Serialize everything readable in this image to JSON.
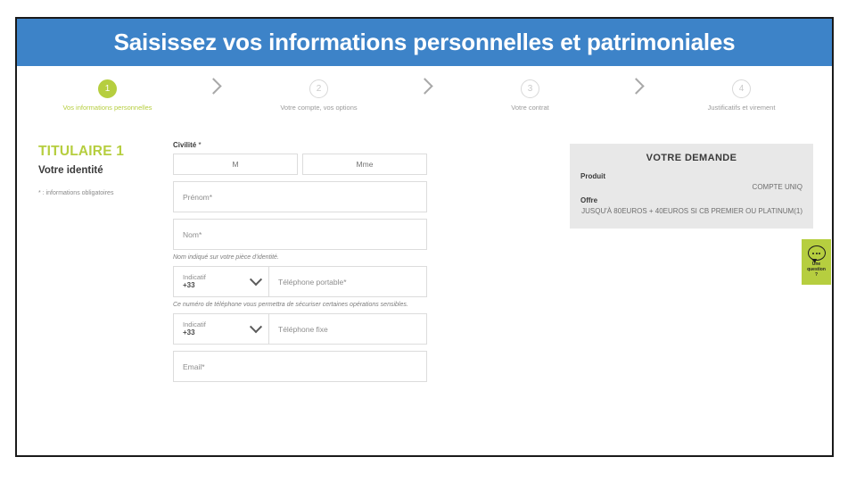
{
  "banner": {
    "title": "Saisissez vos informations personnelles et patrimoniales",
    "background_color": "#3d83c8"
  },
  "theme": {
    "accent_green": "#b6ce3f",
    "header_blue": "#3d83c8",
    "panel_gray": "#e8e8e8"
  },
  "stepper": {
    "steps": [
      {
        "number": "1",
        "label": "Vos informations personnelles",
        "state": "active"
      },
      {
        "number": "2",
        "label": "Votre compte, vos options",
        "state": "inactive"
      },
      {
        "number": "3",
        "label": "Votre contrat",
        "state": "inactive"
      },
      {
        "number": "4",
        "label": "Justificatifs et virement",
        "state": "inactive"
      }
    ]
  },
  "left": {
    "titulaire": "TITULAIRE 1",
    "subtitle": "Votre identité",
    "required_note": ": informations obligatoires",
    "required_mark": "*"
  },
  "form": {
    "civilite": {
      "label": "Civilité",
      "required_mark": "*",
      "options": [
        {
          "label": "M"
        },
        {
          "label": "Mme"
        }
      ]
    },
    "prenom": {
      "placeholder": "Prénom",
      "required_mark": "*",
      "value": ""
    },
    "nom": {
      "placeholder": "Nom",
      "required_mark": "*",
      "value": ""
    },
    "nom_helper": "Nom indiqué sur votre pièce d'identité.",
    "mobile": {
      "indicatif_label": "Indicatif",
      "indicatif_value": "+33",
      "placeholder": "Téléphone portable",
      "required_mark": "*",
      "value": ""
    },
    "mobile_helper": "Ce numéro de téléphone vous permettra de sécuriser certaines opérations sensibles.",
    "fixe": {
      "indicatif_label": "Indicatif",
      "indicatif_value": "+33",
      "placeholder": "Téléphone fixe",
      "required_mark": "",
      "value": ""
    },
    "email": {
      "placeholder": "Email",
      "required_mark": "*",
      "value": ""
    }
  },
  "summary": {
    "title": "VOTRE DEMANDE",
    "rows": [
      {
        "key": "Produit",
        "value": "COMPTE UNIQ"
      },
      {
        "key": "Offre",
        "value": "JUSQU'À 80EUROS + 40EUROS SI CB PREMIER OU PLATINUM(1)"
      }
    ]
  },
  "help_widget": {
    "line1": "Une",
    "line2": "question",
    "line3": "?",
    "icon": "speech-bubble-icon"
  }
}
